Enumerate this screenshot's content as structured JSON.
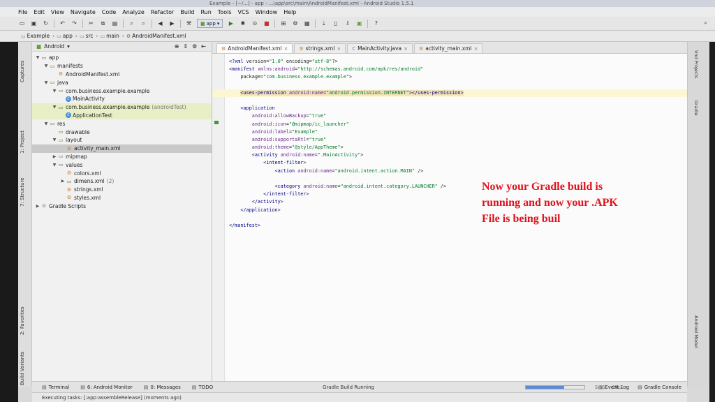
{
  "window": {
    "title": "Example - [~/...] - app - ...\\app\\src\\main\\AndroidManifest.xml - Android Studio 1.5.1"
  },
  "menu": [
    "File",
    "Edit",
    "View",
    "Navigate",
    "Code",
    "Analyze",
    "Refactor",
    "Build",
    "Run",
    "Tools",
    "VCS",
    "Window",
    "Help"
  ],
  "toolbar": {
    "run_config": "app",
    "help": "?"
  },
  "breadcrumb": [
    "Example",
    "app",
    "src",
    "main",
    "AndroidManifest.xml"
  ],
  "left_tabs": {
    "captures": "Captures",
    "project": "1: Project",
    "structure": "7: Structure",
    "favorites": "2: Favorites",
    "build_variants": "Build Variants"
  },
  "project": {
    "view": "Android",
    "tree": [
      {
        "label": "app",
        "depth": 0,
        "icon": "folder-icon",
        "arrow": "▼"
      },
      {
        "label": "manifests",
        "depth": 1,
        "icon": "folder-icon",
        "arrow": "▼"
      },
      {
        "label": "AndroidManifest.xml",
        "depth": 2,
        "icon": "xml-file-icon",
        "arrow": ""
      },
      {
        "label": "java",
        "depth": 1,
        "icon": "folder-icon",
        "arrow": "▼"
      },
      {
        "label": "com.business.example.example",
        "depth": 2,
        "icon": "package-icon",
        "arrow": "▼"
      },
      {
        "label": "MainActivity",
        "depth": 3,
        "icon": "class-icon",
        "arrow": ""
      },
      {
        "label": "com.business.example.example",
        "suffix": "(androidTest)",
        "depth": 2,
        "icon": "package-icon",
        "arrow": "▼",
        "hl": true
      },
      {
        "label": "ApplicationTest",
        "depth": 3,
        "icon": "class-icon",
        "arrow": "",
        "hl": true
      },
      {
        "label": "res",
        "depth": 1,
        "icon": "folder-icon",
        "arrow": "▼"
      },
      {
        "label": "drawable",
        "depth": 2,
        "icon": "folder-icon",
        "arrow": ""
      },
      {
        "label": "layout",
        "depth": 2,
        "icon": "folder-icon",
        "arrow": "▼"
      },
      {
        "label": "activity_main.xml",
        "depth": 3,
        "icon": "xml-file-icon",
        "arrow": "",
        "sel": true
      },
      {
        "label": "mipmap",
        "depth": 2,
        "icon": "folder-icon",
        "arrow": "▶"
      },
      {
        "label": "values",
        "depth": 2,
        "icon": "folder-icon",
        "arrow": "▼"
      },
      {
        "label": "colors.xml",
        "depth": 3,
        "icon": "xml-file-icon",
        "arrow": ""
      },
      {
        "label": "dimens.xml",
        "suffix": "(2)",
        "depth": 3,
        "icon": "folder-icon",
        "arrow": "▶"
      },
      {
        "label": "strings.xml",
        "depth": 3,
        "icon": "xml-file-icon",
        "arrow": ""
      },
      {
        "label": "styles.xml",
        "depth": 3,
        "icon": "xml-file-icon",
        "arrow": ""
      },
      {
        "label": "Gradle Scripts",
        "depth": 0,
        "icon": "gradle-icon",
        "arrow": "▶"
      }
    ]
  },
  "tabs": [
    {
      "label": "AndroidManifest.xml",
      "active": true,
      "kind": "xml"
    },
    {
      "label": "strings.xml",
      "active": false,
      "kind": "xml"
    },
    {
      "label": "MainActivity.java",
      "active": false,
      "kind": "java"
    },
    {
      "label": "activity_main.xml",
      "active": false,
      "kind": "xml"
    }
  ],
  "code_lines": [
    "<?xml version=\"1.0\" encoding=\"utf-8\"?>",
    "<manifest xmlns:android=\"http://schemas.android.com/apk/res/android\"",
    "    package=\"com.business.example.example\">",
    "",
    "    <uses-permission android:name=\"android.permission.INTERNET\"></uses-permission>",
    "",
    "    <application",
    "        android:allowBackup=\"true\"",
    "        android:icon=\"@mipmap/ic_launcher\"",
    "        android:label=\"Example\"",
    "        android:supportsRtl=\"true\"",
    "        android:theme=\"@style/AppTheme\">",
    "        <activity android:name=\".MainActivity\">",
    "            <intent-filter>",
    "                <action android:name=\"android.intent.action.MAIN\" />",
    "",
    "                <category android:name=\"android.intent.category.LAUNCHER\" />",
    "            </intent-filter>",
    "        </activity>",
    "    </application>",
    "",
    "</manifest>"
  ],
  "overlay_text": "Now your Gradle build is running and now your .APK File is being buil",
  "right_tabs": {
    "vnd": "Android Model",
    "gradle": "Gradle",
    "android_model": "Android Model"
  },
  "bottom_tabs": [
    {
      "label": "Terminal",
      "icon": "terminal-icon"
    },
    {
      "label": "6: Android Monitor",
      "icon": "android-icon"
    },
    {
      "label": "0: Messages",
      "icon": "messages-icon"
    },
    {
      "label": "TODO",
      "icon": "todo-icon"
    }
  ],
  "bottom_right": {
    "event_log": "Event Log",
    "gradle_console": "Gradle Console"
  },
  "build_status": "Gradle Build Running",
  "build_progress": 0.65,
  "cursor_pos": "5:55",
  "line_sep": "CRLF",
  "status_text": "Executing tasks: [:app:assembleRelease] (moments ago)"
}
